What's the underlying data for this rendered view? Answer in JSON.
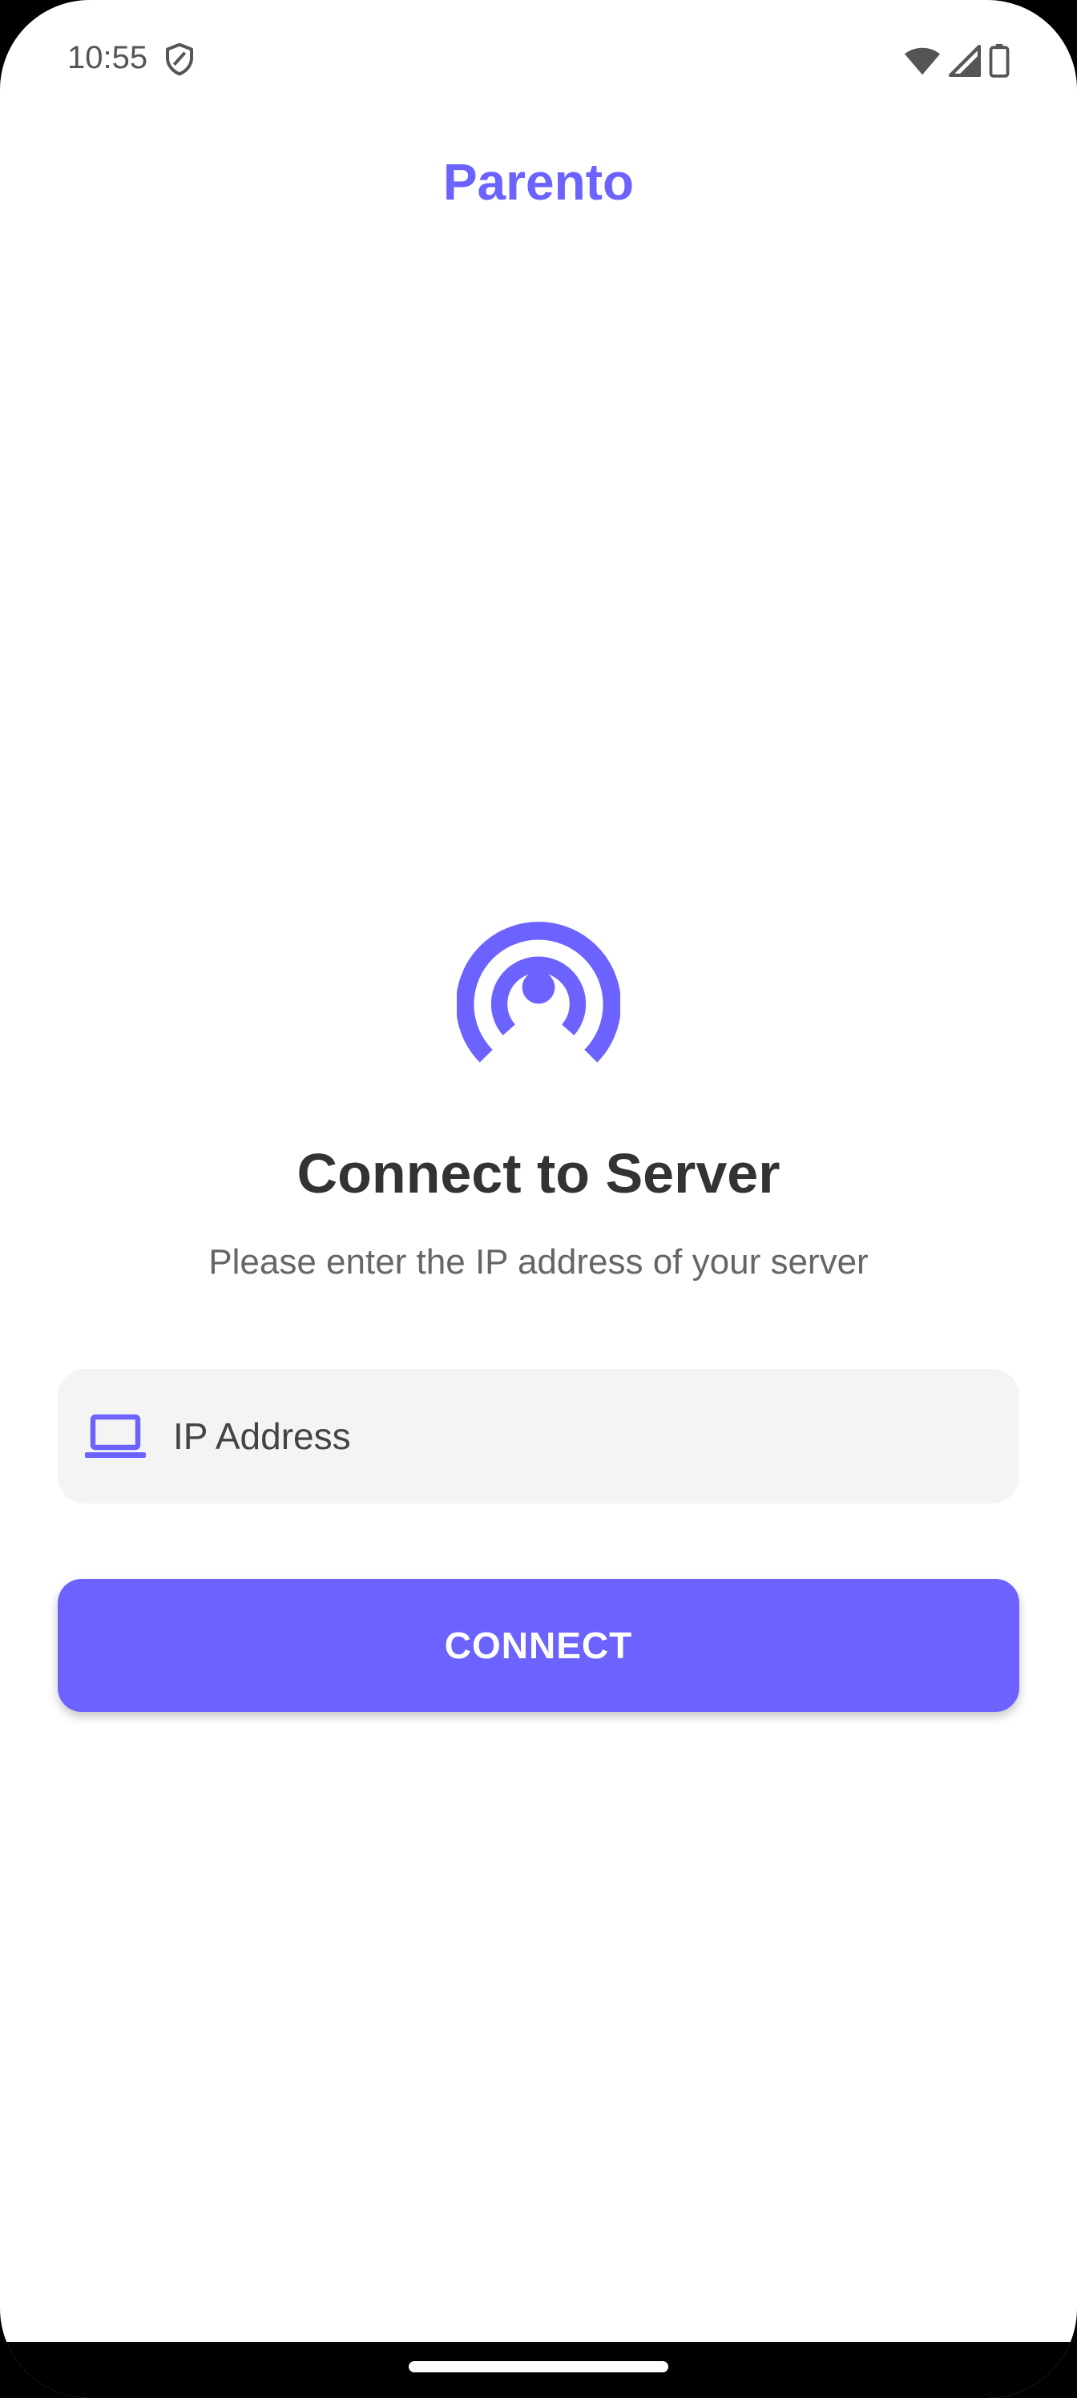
{
  "status_bar": {
    "time": "10:55",
    "icons": [
      "shield-icon",
      "wifi-icon",
      "cell-signal-icon",
      "battery-icon"
    ]
  },
  "app": {
    "title": "Parento",
    "accent_color": "#6c63ff"
  },
  "main": {
    "hero_icon": "broadcast-tower-icon",
    "heading": "Connect to Server",
    "subheading": "Please enter the IP address of your server",
    "ip_field": {
      "icon": "laptop-icon",
      "placeholder": "IP Address",
      "value": ""
    },
    "connect_label": "CONNECT"
  }
}
